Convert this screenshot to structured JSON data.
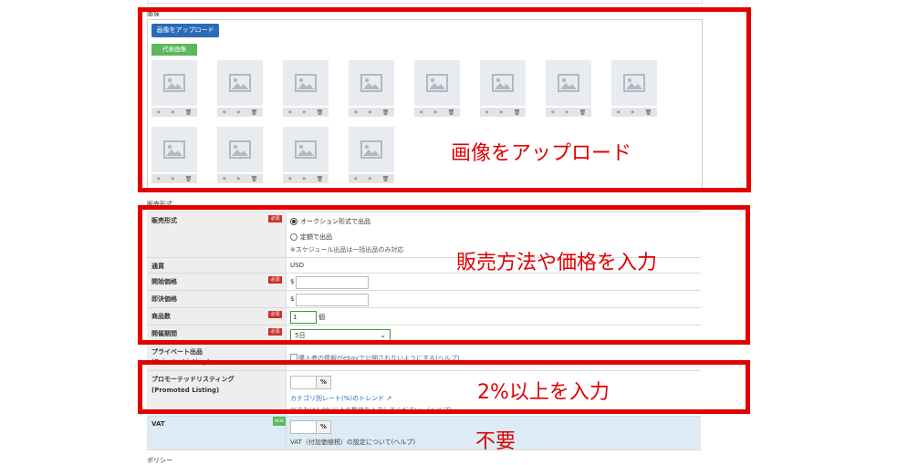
{
  "images_section": {
    "title": "画像",
    "upload_button": "画像をアップロード",
    "representative_badge": "代表画像",
    "thumb_controls": [
      "«",
      "»",
      "🗑"
    ]
  },
  "sales_section": {
    "title": "販売形式",
    "rows": {
      "format": {
        "label": "販売形式",
        "required": "必須",
        "option_auction": "オークション形式で出品",
        "option_fixed": "定額で出品",
        "note": "※スケジュール出品は一括出品のみ対応"
      },
      "currency": {
        "label": "通貨",
        "value": "USD"
      },
      "start_price": {
        "label": "開始価格",
        "required": "必須",
        "prefix": "$"
      },
      "buy_now_price": {
        "label": "即決価格",
        "prefix": "$"
      },
      "quantity": {
        "label": "商品数",
        "required": "必須",
        "value": "1",
        "unit": "個"
      },
      "duration": {
        "label": "開催期間",
        "required": "必須",
        "value": "5日"
      },
      "private": {
        "label": "プライベート出品",
        "label_sub": "(Private Listing)",
        "checkbox_text": "購入者の情報がebayで公開されないようにする(ヘルプ)"
      },
      "promoted": {
        "label": "プロモーテッドリスティング",
        "label_sub": "(Promoted Listing)",
        "unit": "%",
        "trend_link": "カテゴリ別レート(%)のトレンド",
        "note": "0(または1.0%以上の数値を入力してください。(ヘルプ)"
      },
      "vat": {
        "label": "VAT",
        "badge": "NEW",
        "unit": "%",
        "note": "VAT（付加価値税）の設定について(ヘルプ)"
      }
    }
  },
  "policy_section": {
    "title": "ポリシー"
  },
  "annotations": {
    "upload": "画像をアップロード",
    "sales": "販売方法や価格を入力",
    "promoted": "2%以上を入力",
    "vat": "不要"
  }
}
